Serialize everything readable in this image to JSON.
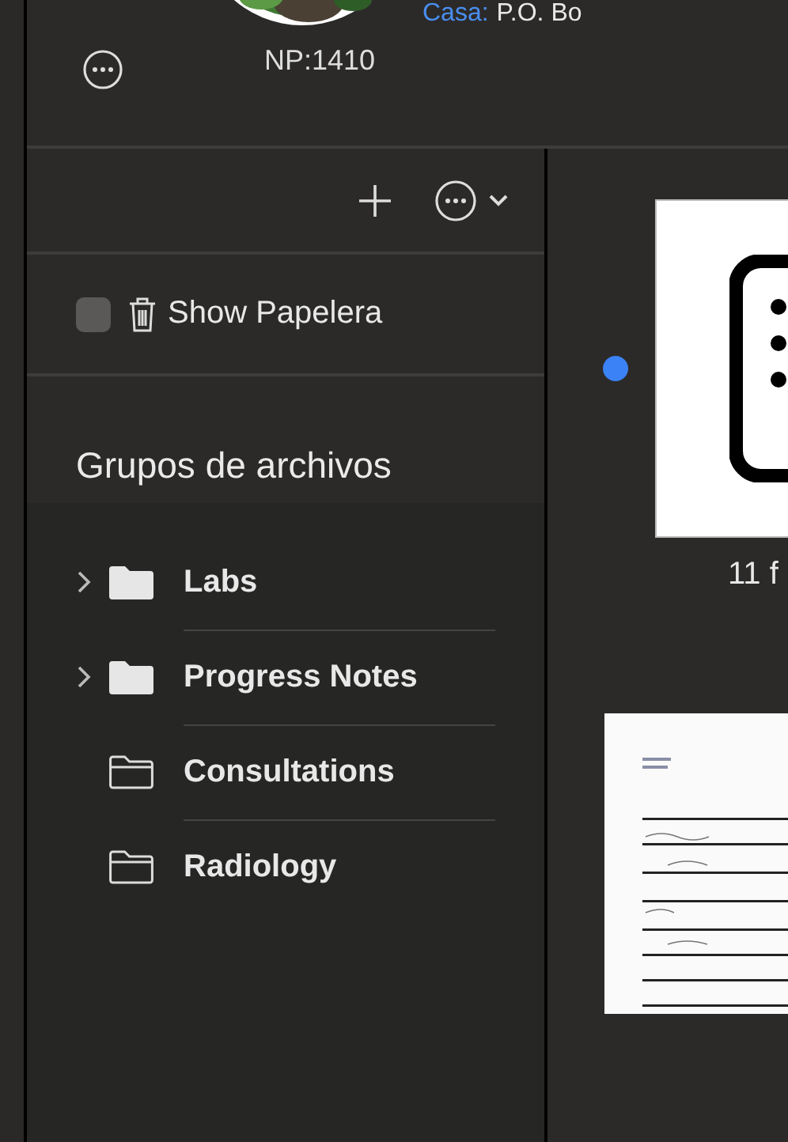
{
  "header": {
    "np_label": "NP:1410",
    "address_label": "Casa:",
    "address_value": "P.O. Bo"
  },
  "show_trash": {
    "label": "Show Papelera",
    "checked": false
  },
  "groups": {
    "title": "Grupos de archivos",
    "items": [
      {
        "name": "Labs",
        "expandable": true
      },
      {
        "name": "Progress Notes",
        "expandable": true
      },
      {
        "name": "Consultations",
        "expandable": false
      },
      {
        "name": "Radiology",
        "expandable": false
      }
    ]
  },
  "files": [
    {
      "kind": "icon",
      "unread": true,
      "caption": "11 f"
    },
    {
      "kind": "picture",
      "unread": false
    }
  ]
}
